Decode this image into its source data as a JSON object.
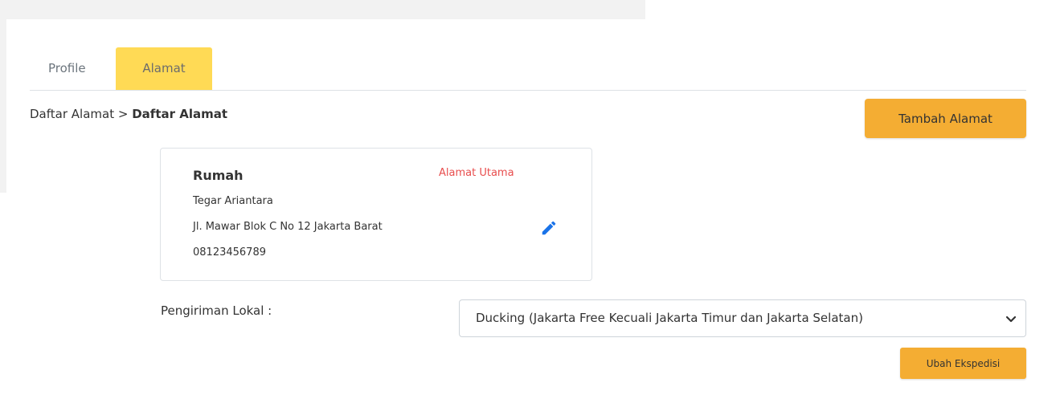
{
  "tabs": [
    {
      "label": "Profile",
      "active": false
    },
    {
      "label": "Alamat",
      "active": true
    }
  ],
  "breadcrumb": {
    "parent": "Daftar Alamat",
    "separator": ">",
    "current": "Daftar Alamat"
  },
  "actions": {
    "add_address_label": "Tambah Alamat",
    "change_shipping_label": "Ubah Ekspedisi"
  },
  "address_card": {
    "title": "Rumah",
    "badge": "Alamat Utama",
    "name": "Tegar Ariantara",
    "address": "Jl. Mawar Blok C No 12 Jakarta Barat",
    "phone": "08123456789",
    "edit_icon": "pencil-icon"
  },
  "shipping": {
    "label": "Pengiriman Lokal :",
    "selected": "Ducking (Jakarta Free Kecuali Jakarta Timur dan Jakarta Selatan)",
    "chevron_icon": "chevron-down-icon"
  },
  "colors": {
    "active_tab": "#ffda55",
    "button": "#f4ad33",
    "badge": "#e84d4d",
    "edit_icon": "#1a73e8"
  }
}
